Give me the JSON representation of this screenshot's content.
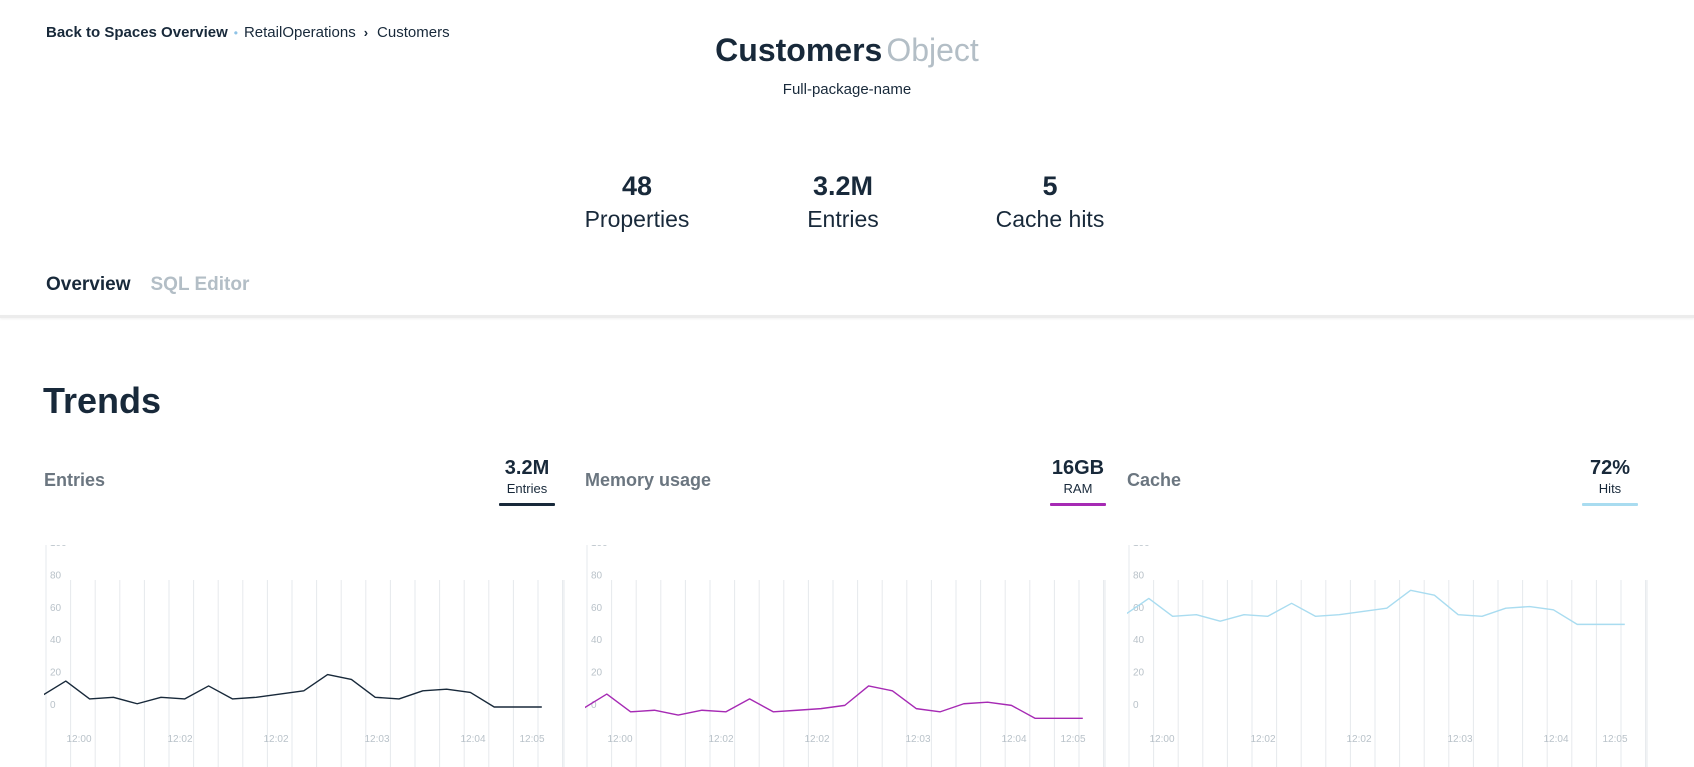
{
  "breadcrumb": {
    "back_label": "Back to Spaces Overview",
    "separator_dot": "•",
    "space": "RetailOperations",
    "chevron": "›",
    "current": "Customers"
  },
  "header": {
    "title": "Customers",
    "title_suffix": "Object",
    "package_name": "Full-package-name"
  },
  "stats": [
    {
      "value": "48",
      "label": "Properties"
    },
    {
      "value": "3.2M",
      "label": "Entries"
    },
    {
      "value": "5",
      "label": "Cache hits"
    }
  ],
  "tabs": [
    {
      "label": "Overview",
      "active": true
    },
    {
      "label": "SQL Editor",
      "active": false
    }
  ],
  "section_title": "Trends",
  "colors": {
    "entries": "#18293a",
    "memory": "#a62ab4",
    "cache": "#a9dcf0",
    "grid": "#e6e9ec",
    "tick": "#b9c2c9"
  },
  "panels": [
    {
      "title": "Entries",
      "metric_value": "3.2M",
      "metric_label": "Entries",
      "color_key": "entries"
    },
    {
      "title": "Memory usage",
      "metric_value": "16GB",
      "metric_label": "RAM",
      "color_key": "memory"
    },
    {
      "title": "Cache",
      "metric_value": "72%",
      "metric_label": "Hits",
      "color_key": "cache"
    }
  ],
  "chart_data": [
    {
      "type": "line",
      "title": "Entries",
      "x": [
        "12:00",
        "",
        "",
        "",
        "",
        "12:02",
        "",
        "",
        "",
        "12:02",
        "",
        "",
        "",
        "12:03",
        "",
        "",
        "",
        "12:04",
        "",
        "",
        "12:05",
        ""
      ],
      "series": [
        {
          "values": [
            7,
            16,
            5,
            6,
            2,
            6,
            5,
            13,
            5,
            6,
            8,
            10,
            20,
            17,
            6,
            5,
            10,
            11,
            9,
            0,
            0,
            0
          ]
        }
      ],
      "yticks": [
        0,
        20,
        40,
        60,
        80,
        100
      ],
      "ylim": [
        0,
        100
      ],
      "xtick_labels": [
        "12:00",
        "12:02",
        "12:02",
        "12:03",
        "12:04",
        "12:05"
      ],
      "grid": true
    },
    {
      "type": "line",
      "title": "Memory usage",
      "x": [
        "12:00",
        "",
        "",
        "",
        "",
        "12:02",
        "",
        "",
        "",
        "12:02",
        "",
        "",
        "",
        "12:03",
        "",
        "",
        "",
        "12:04",
        "",
        "",
        "12:05",
        ""
      ],
      "series": [
        {
          "values": [
            -1,
            8,
            -3,
            -2,
            -5,
            -2,
            -3,
            5,
            -3,
            -2,
            -1,
            1,
            13,
            10,
            -1,
            -3,
            2,
            3,
            1,
            -7,
            -7,
            -7
          ]
        }
      ],
      "yticks": [
        0,
        20,
        40,
        60,
        80,
        100
      ],
      "ylim": [
        0,
        100
      ],
      "xtick_labels": [
        "12:00",
        "12:02",
        "12:02",
        "12:03",
        "12:04",
        "12:05"
      ],
      "grid": true
    },
    {
      "type": "line",
      "title": "Cache",
      "x": [
        "12:00",
        "",
        "",
        "",
        "",
        "12:02",
        "",
        "",
        "",
        "12:02",
        "",
        "",
        "",
        "12:03",
        "",
        "",
        "",
        "12:04",
        "",
        "",
        "12:05",
        ""
      ],
      "series": [
        {
          "values": [
            57,
            67,
            56,
            57,
            53,
            57,
            56,
            64,
            56,
            57,
            59,
            61,
            72,
            69,
            57,
            56,
            61,
            62,
            60,
            51,
            51,
            51
          ]
        }
      ],
      "yticks": [
        0,
        20,
        40,
        60,
        80,
        100
      ],
      "ylim": [
        0,
        100
      ],
      "xtick_labels": [
        "12:00",
        "12:02",
        "12:02",
        "12:03",
        "12:04",
        "12:05"
      ],
      "grid": true
    }
  ]
}
